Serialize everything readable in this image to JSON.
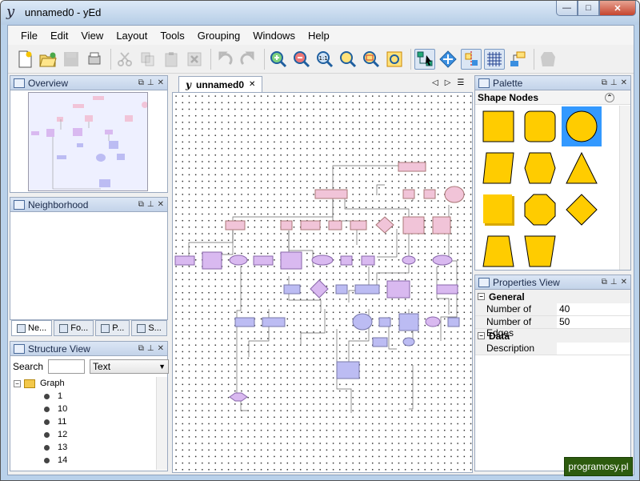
{
  "window": {
    "title": "unnamed0 - yEd",
    "app_logo": "y",
    "minimize": "—",
    "maximize": "□",
    "close": "✕"
  },
  "menu": [
    "File",
    "Edit",
    "View",
    "Layout",
    "Tools",
    "Grouping",
    "Windows",
    "Help"
  ],
  "toolbar": [
    "new-document-icon",
    "open-icon",
    "save-icon",
    "print-icon",
    "cut-icon",
    "copy-icon",
    "paste-icon",
    "delete-icon",
    "undo-icon",
    "redo-icon",
    "zoom-in-icon",
    "zoom-out-icon",
    "zoom-100-icon",
    "zoom-fit-icon",
    "zoom-area-icon",
    "fit-content-icon",
    "edit-mode-icon",
    "navigation-mode-icon",
    "snap-lines-icon",
    "grid-icon",
    "create-group-icon",
    "settings-icon"
  ],
  "overview": {
    "title": "Overview"
  },
  "neighborhood": {
    "title": "Neighborhood"
  },
  "left_tabs": [
    "Ne...",
    "Fo...",
    "P...",
    "S..."
  ],
  "structure": {
    "title": "Structure View",
    "search_label": "Search",
    "search_value": "",
    "filter_value": "Text",
    "root": "Graph",
    "items": [
      "1",
      "10",
      "11",
      "12",
      "13",
      "14"
    ]
  },
  "editor": {
    "tab_label": "unnamed0",
    "tab_close": "✕",
    "nav": [
      "◁",
      "▷",
      "☰"
    ]
  },
  "palette": {
    "title": "Palette",
    "section": "Shape Nodes",
    "shapes": [
      "rectangle",
      "rounded-rectangle",
      "ellipse",
      "parallelogram",
      "hexagon",
      "triangle",
      "shadow-rectangle",
      "octagon",
      "diamond",
      "trapezoid",
      "inverted-trapezoid"
    ]
  },
  "properties": {
    "title": "Properties View",
    "general": "General",
    "nodes_label": "Number of Nodes",
    "nodes_value": "40",
    "edges_label": "Number of Edges",
    "edges_value": "50",
    "data": "Data",
    "description_label": "Description",
    "description_value": ""
  },
  "watermark": "programosy.pl",
  "colors": {
    "pink_node": "#f1c4d8",
    "violet_node": "#d9b9f0",
    "blue_node": "#bcbcf3",
    "palette_fill": "#ffcc00",
    "selected": "#3399ff"
  }
}
